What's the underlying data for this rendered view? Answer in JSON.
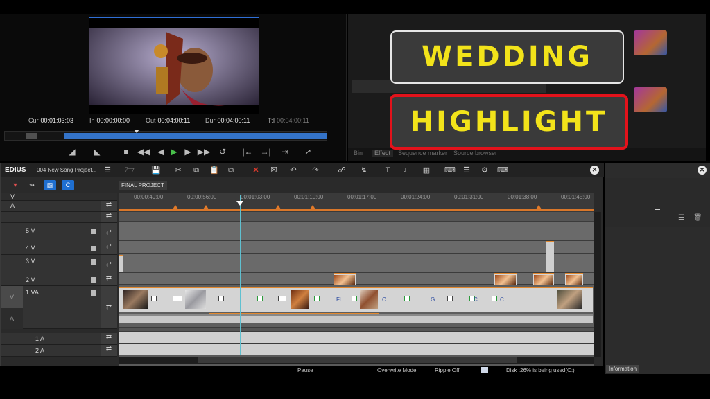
{
  "player": {
    "cur_label": "Cur",
    "cur": "00:01:03:03",
    "in_label": "In",
    "in": "00:00:00:00",
    "out_label": "Out",
    "out": "00:04:00:11",
    "dur_label": "Dur",
    "dur": "00:04:00:11",
    "ttl_label": "Ttl",
    "ttl": "00:04:00:11"
  },
  "effects_panel": {
    "tabs": [
      "Bin",
      "Effect",
      "Sequence marker",
      "Source browser"
    ],
    "active_tab": "Effect"
  },
  "overlay": {
    "line1": "WEDDING",
    "line2": "HIGHLIGHT"
  },
  "timeline": {
    "app_name": "EDIUS",
    "project_name": "004 New Song Project...",
    "sequence_tab": "FINAL PROJECT",
    "ruler_ticks": [
      "00:00:49:00",
      "00:00:56:00",
      "00:01:03:00",
      "00:01:10:00",
      "00:01:17:00",
      "00:01:24:00",
      "00:01:31:00",
      "00:01:38:00",
      "00:01:45:00"
    ],
    "tracks": {
      "v": "V",
      "a": "A",
      "v5": "5 V",
      "v4": "4 V",
      "v3": "3 V",
      "v2": "2 V",
      "va1": "1 VA",
      "a1": "1 A",
      "a2": "2 A",
      "va_side": "V",
      "a_side": "A"
    },
    "clip_labels": [
      "Fl...",
      "C...",
      "G...",
      "C...",
      "C..."
    ]
  },
  "status": {
    "pause": "Pause",
    "mode": "Overwrite Mode",
    "ripple": "Ripple Off",
    "disk": "Disk :26% is being used(C:)"
  },
  "info_panel": {
    "tab": "Information"
  },
  "colors": {
    "accent_blue": "#3473c8",
    "title_yellow": "#f2e31a",
    "highlight_border": "#e3121b",
    "clip_orange": "#e2892f"
  }
}
